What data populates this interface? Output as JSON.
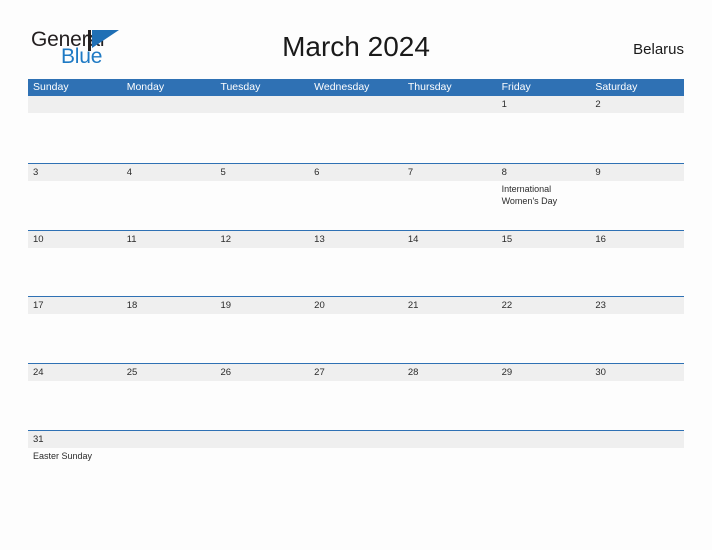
{
  "brand": {
    "name_part1": "General",
    "name_part2": "Blue",
    "flag_icon": "general-blue-flag-logo",
    "accent_color": "#1f7ac4"
  },
  "header": {
    "title": "March 2024",
    "country": "Belarus"
  },
  "colors": {
    "header_blue": "#2f71b4",
    "row_divider_blue": "#2f71b4",
    "date_band_gray": "#efefef",
    "page_background": "#fdfdfd",
    "text_dark": "#2b2b2b"
  },
  "calendar": {
    "day_names": [
      "Sunday",
      "Monday",
      "Tuesday",
      "Wednesday",
      "Thursday",
      "Friday",
      "Saturday"
    ],
    "weeks": [
      [
        {
          "date": "",
          "event": ""
        },
        {
          "date": "",
          "event": ""
        },
        {
          "date": "",
          "event": ""
        },
        {
          "date": "",
          "event": ""
        },
        {
          "date": "",
          "event": ""
        },
        {
          "date": "1",
          "event": ""
        },
        {
          "date": "2",
          "event": ""
        }
      ],
      [
        {
          "date": "3",
          "event": ""
        },
        {
          "date": "4",
          "event": ""
        },
        {
          "date": "5",
          "event": ""
        },
        {
          "date": "6",
          "event": ""
        },
        {
          "date": "7",
          "event": ""
        },
        {
          "date": "8",
          "event": "International Women's Day"
        },
        {
          "date": "9",
          "event": ""
        }
      ],
      [
        {
          "date": "10",
          "event": ""
        },
        {
          "date": "11",
          "event": ""
        },
        {
          "date": "12",
          "event": ""
        },
        {
          "date": "13",
          "event": ""
        },
        {
          "date": "14",
          "event": ""
        },
        {
          "date": "15",
          "event": ""
        },
        {
          "date": "16",
          "event": ""
        }
      ],
      [
        {
          "date": "17",
          "event": ""
        },
        {
          "date": "18",
          "event": ""
        },
        {
          "date": "19",
          "event": ""
        },
        {
          "date": "20",
          "event": ""
        },
        {
          "date": "21",
          "event": ""
        },
        {
          "date": "22",
          "event": ""
        },
        {
          "date": "23",
          "event": ""
        }
      ],
      [
        {
          "date": "24",
          "event": ""
        },
        {
          "date": "25",
          "event": ""
        },
        {
          "date": "26",
          "event": ""
        },
        {
          "date": "27",
          "event": ""
        },
        {
          "date": "28",
          "event": ""
        },
        {
          "date": "29",
          "event": ""
        },
        {
          "date": "30",
          "event": ""
        }
      ],
      [
        {
          "date": "31",
          "event": "Easter Sunday"
        },
        {
          "date": "",
          "event": ""
        },
        {
          "date": "",
          "event": ""
        },
        {
          "date": "",
          "event": ""
        },
        {
          "date": "",
          "event": ""
        },
        {
          "date": "",
          "event": ""
        },
        {
          "date": "",
          "event": ""
        }
      ]
    ]
  }
}
